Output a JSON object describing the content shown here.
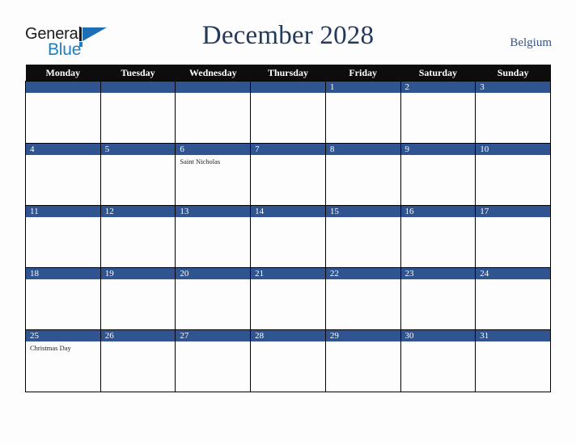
{
  "brand": {
    "name_part1": "General",
    "name_part2": "Blue",
    "mark": "triangle-logo-mark"
  },
  "header": {
    "title": "December 2028",
    "region": "Belgium"
  },
  "colors": {
    "accent_blue": "#2f5490",
    "header_black": "#0d0d0d",
    "title_navy": "#23395d",
    "logo_blue": "#1c7fc4",
    "page_background": "#fdfdfd"
  },
  "calendar": {
    "weekday_headers": [
      "Monday",
      "Tuesday",
      "Wednesday",
      "Thursday",
      "Friday",
      "Saturday",
      "Sunday"
    ],
    "weeks": [
      [
        {
          "date": "",
          "events": []
        },
        {
          "date": "",
          "events": []
        },
        {
          "date": "",
          "events": []
        },
        {
          "date": "",
          "events": []
        },
        {
          "date": "1",
          "events": []
        },
        {
          "date": "2",
          "events": []
        },
        {
          "date": "3",
          "events": []
        }
      ],
      [
        {
          "date": "4",
          "events": []
        },
        {
          "date": "5",
          "events": []
        },
        {
          "date": "6",
          "events": [
            "Saint Nicholas"
          ]
        },
        {
          "date": "7",
          "events": []
        },
        {
          "date": "8",
          "events": []
        },
        {
          "date": "9",
          "events": []
        },
        {
          "date": "10",
          "events": []
        }
      ],
      [
        {
          "date": "11",
          "events": []
        },
        {
          "date": "12",
          "events": []
        },
        {
          "date": "13",
          "events": []
        },
        {
          "date": "14",
          "events": []
        },
        {
          "date": "15",
          "events": []
        },
        {
          "date": "16",
          "events": []
        },
        {
          "date": "17",
          "events": []
        }
      ],
      [
        {
          "date": "18",
          "events": []
        },
        {
          "date": "19",
          "events": []
        },
        {
          "date": "20",
          "events": []
        },
        {
          "date": "21",
          "events": []
        },
        {
          "date": "22",
          "events": []
        },
        {
          "date": "23",
          "events": []
        },
        {
          "date": "24",
          "events": []
        }
      ],
      [
        {
          "date": "25",
          "events": [
            "Christmas Day"
          ]
        },
        {
          "date": "26",
          "events": []
        },
        {
          "date": "27",
          "events": []
        },
        {
          "date": "28",
          "events": []
        },
        {
          "date": "29",
          "events": []
        },
        {
          "date": "30",
          "events": []
        },
        {
          "date": "31",
          "events": []
        }
      ]
    ]
  }
}
